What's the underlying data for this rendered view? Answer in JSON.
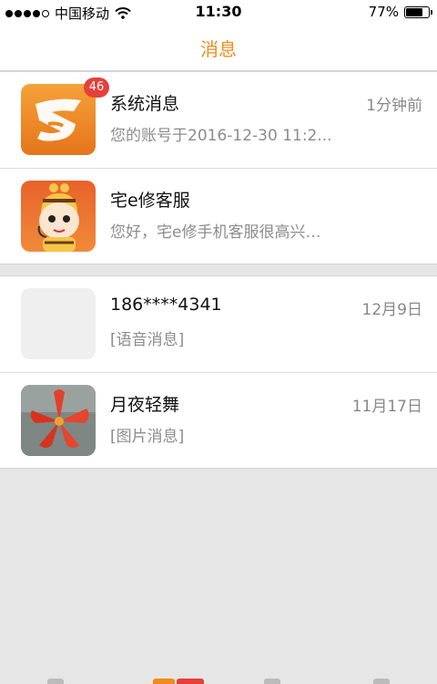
{
  "statusbar": {
    "carrier": "中国移动",
    "time": "11:30",
    "battery": "77%",
    "battery_level": 0.77
  },
  "header": {
    "title": "消息"
  },
  "conversations": [
    {
      "name": "系统消息",
      "time": "1分钟前",
      "preview": "您的账号于2016-12-30 11:2...",
      "badge": "46",
      "avatar_icon": "app-logo-icon"
    },
    {
      "name": "宅e修客服",
      "time": "",
      "preview": "您好，宅e修手机客服很高兴…",
      "avatar_icon": "cartoon-bee-icon"
    },
    {
      "name": "186****4341",
      "time": "12月9日",
      "preview": "[语音消息]",
      "avatar_icon": "blank-avatar"
    },
    {
      "name": "月夜轻舞",
      "time": "11月17日",
      "preview": "[图片消息]",
      "avatar_icon": "red-flower-photo"
    }
  ],
  "colors": {
    "accent": "#f08c1b",
    "badge": "#e5403b"
  }
}
